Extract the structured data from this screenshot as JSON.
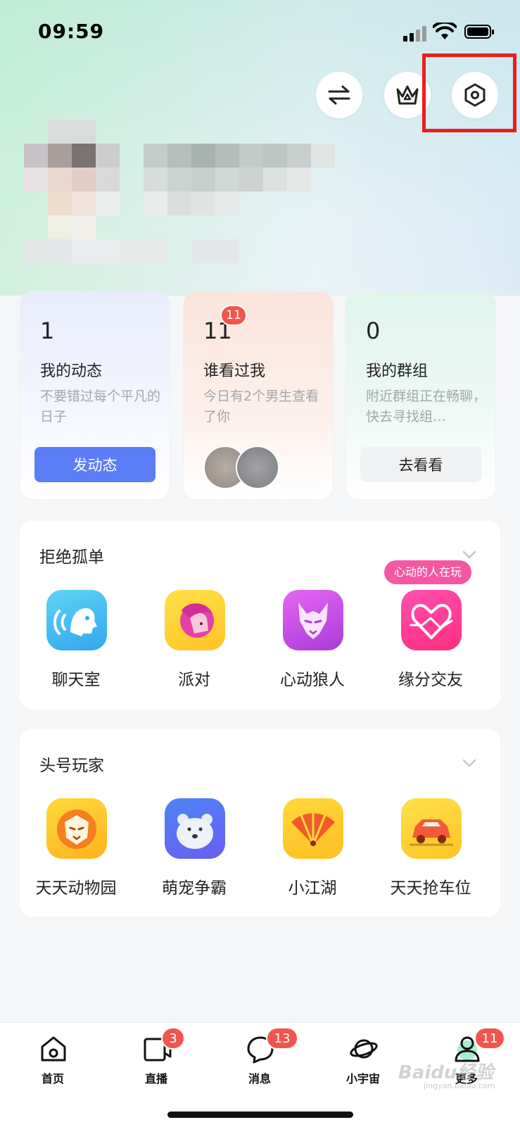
{
  "status_bar": {
    "time": "09:59"
  },
  "header_actions": [
    {
      "name": "switch-icon"
    },
    {
      "name": "crown-icon"
    },
    {
      "name": "settings-icon"
    }
  ],
  "stat_cards": [
    {
      "count": "1",
      "title": "我的动态",
      "desc": "不要错过每个平凡的日子",
      "button": "发动态",
      "accent": "#5b7df6"
    },
    {
      "count": "11",
      "badge": "11",
      "title": "谁看过我",
      "desc": "今日有2个男生查看了你"
    },
    {
      "count": "0",
      "title": "我的群组",
      "desc": "附近群组正在畅聊，快去寻找组…",
      "button": "去看看"
    }
  ],
  "sections": [
    {
      "title": "拒绝孤单",
      "items": [
        {
          "label": "聊天室",
          "icon": "chatroom-icon"
        },
        {
          "label": "派对",
          "icon": "party-icon"
        },
        {
          "label": "心动狼人",
          "icon": "werewolf-icon"
        },
        {
          "label": "缘分交友",
          "icon": "heart-match-icon",
          "tag": "心动的人在玩"
        }
      ]
    },
    {
      "title": "头号玩家",
      "items": [
        {
          "label": "天天动物园",
          "icon": "lion-icon"
        },
        {
          "label": "萌宠争霸",
          "icon": "bear-icon"
        },
        {
          "label": "小江湖",
          "icon": "fan-icon"
        },
        {
          "label": "天天抢车位",
          "icon": "car-icon"
        }
      ]
    }
  ],
  "tab_bar": [
    {
      "label": "首页",
      "icon": "home-icon"
    },
    {
      "label": "直播",
      "icon": "live-icon",
      "badge": "3"
    },
    {
      "label": "消息",
      "icon": "message-icon",
      "badge": "13"
    },
    {
      "label": "小宇宙",
      "icon": "planet-icon"
    },
    {
      "label": "更多",
      "icon": "profile-icon",
      "badge": "11"
    }
  ],
  "watermark": {
    "text": "Baidu经验",
    "sub": "jingyan.baidu.com"
  }
}
